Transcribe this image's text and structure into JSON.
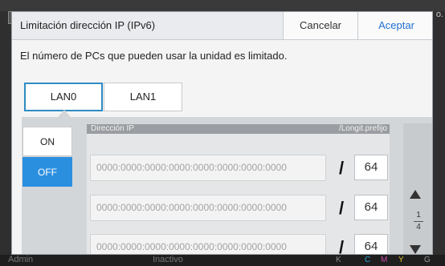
{
  "background": {
    "corner_icon": "⎘",
    "corner_text": "o.",
    "user_label": "Admin",
    "status_label": "Inactivo",
    "ink_labels": [
      "K",
      "C",
      "M",
      "Y",
      "G"
    ]
  },
  "dialog": {
    "title": "Limitación dirección IP (IPv6)",
    "cancel_label": "Cancelar",
    "accept_label": "Aceptar",
    "description": "El número de PCs que pueden usar la unidad es limitado.",
    "tabs": [
      {
        "label": "LAN0",
        "active": true
      },
      {
        "label": "LAN1",
        "active": false
      }
    ],
    "on_label": "ON",
    "off_label": "OFF",
    "selected_toggle": "OFF",
    "list": {
      "header_ip": "Dirección IP",
      "header_prefix": "/Longit.prefijo",
      "separator": "/",
      "rows": [
        {
          "address_placeholder": "0000:0000:0000:0000:0000:0000:0000:0000",
          "prefix": "64"
        },
        {
          "address_placeholder": "0000:0000:0000:0000:0000:0000:0000:0000",
          "prefix": "64"
        },
        {
          "address_placeholder": "0000:0000:0000:0000:0000:0000:0000:0000",
          "prefix": "64"
        }
      ]
    },
    "pager": {
      "current": "1",
      "total": "4",
      "up_icon": "triangle-up-icon",
      "down_icon": "triangle-down-icon"
    }
  },
  "colors": {
    "accent": "#2b8fe0",
    "tab_border": "#2f8cc4",
    "accept_text": "#1f6fd1"
  }
}
